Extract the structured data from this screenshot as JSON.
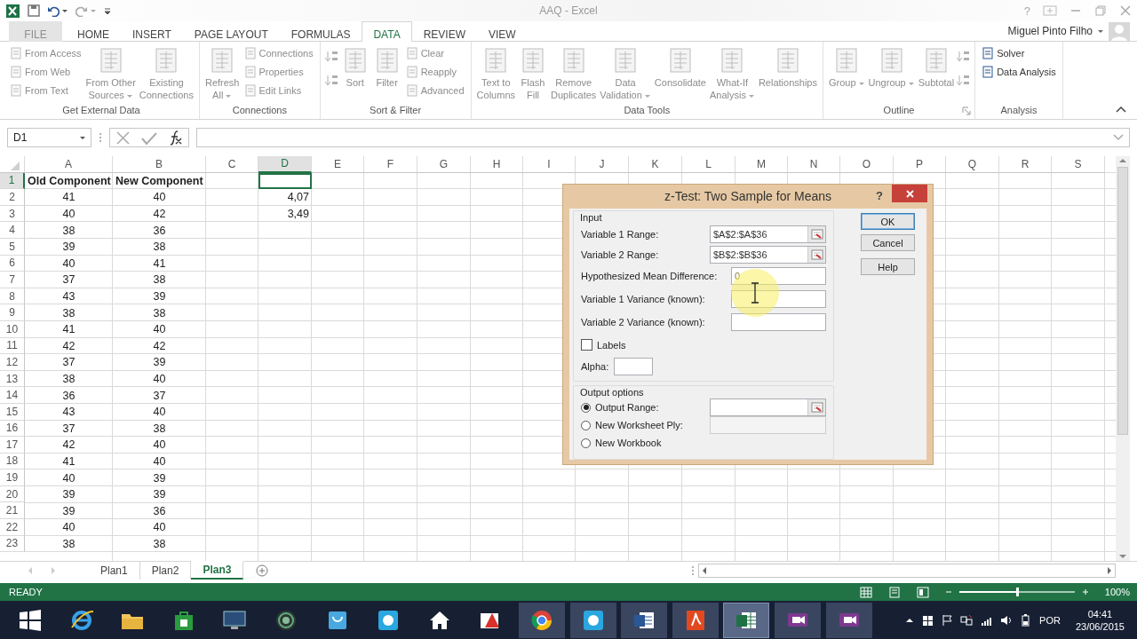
{
  "window": {
    "title": "AAQ - Excel",
    "help_glyph": "?"
  },
  "ribbon_tabs": [
    {
      "label": "FILE",
      "kind": "file",
      "selected": false
    },
    {
      "label": "HOME",
      "kind": "tab",
      "selected": false
    },
    {
      "label": "INSERT",
      "kind": "tab",
      "selected": false
    },
    {
      "label": "PAGE LAYOUT",
      "kind": "tab",
      "selected": false
    },
    {
      "label": "FORMULAS",
      "kind": "tab",
      "selected": false
    },
    {
      "label": "DATA",
      "kind": "tab",
      "selected": true
    },
    {
      "label": "REVIEW",
      "kind": "tab",
      "selected": false
    },
    {
      "label": "VIEW",
      "kind": "tab",
      "selected": false
    }
  ],
  "account": {
    "name": "Miguel Pinto Filho"
  },
  "ribbon_groups": [
    {
      "label": "Get External Data",
      "launcher": false,
      "items": [
        {
          "kind": "small",
          "label": "From Access",
          "disabled": true
        },
        {
          "kind": "small",
          "label": "From Web",
          "disabled": true
        },
        {
          "kind": "small",
          "label": "From Text",
          "disabled": true
        },
        {
          "kind": "large",
          "label": "From Other\nSources",
          "dropdown": true,
          "disabled": true
        },
        {
          "kind": "large",
          "label": "Existing\nConnections",
          "dropdown": false,
          "disabled": true
        }
      ]
    },
    {
      "label": "Connections",
      "launcher": false,
      "items": [
        {
          "kind": "large",
          "label": "Refresh\nAll",
          "dropdown": true,
          "disabled": true
        },
        {
          "kind": "small",
          "label": "Connections",
          "disabled": true
        },
        {
          "kind": "small",
          "label": "Properties",
          "disabled": true
        },
        {
          "kind": "small",
          "label": "Edit Links",
          "disabled": true
        }
      ]
    },
    {
      "label": "Sort & Filter",
      "launcher": false,
      "items": [
        {
          "kind": "icon",
          "disabled": true
        },
        {
          "kind": "icon",
          "disabled": true
        },
        {
          "kind": "large",
          "label": "Sort",
          "dropdown": false,
          "disabled": true
        },
        {
          "kind": "large",
          "label": "Filter",
          "dropdown": false,
          "disabled": true
        },
        {
          "kind": "small",
          "label": "Clear",
          "disabled": true
        },
        {
          "kind": "small",
          "label": "Reapply",
          "disabled": true
        },
        {
          "kind": "small",
          "label": "Advanced",
          "disabled": true
        }
      ]
    },
    {
      "label": "Data Tools",
      "launcher": false,
      "items": [
        {
          "kind": "large",
          "label": "Text to\nColumns",
          "dropdown": false,
          "disabled": true
        },
        {
          "kind": "large",
          "label": "Flash\nFill",
          "dropdown": false,
          "disabled": true
        },
        {
          "kind": "large",
          "label": "Remove\nDuplicates",
          "dropdown": false,
          "disabled": true
        },
        {
          "kind": "large",
          "label": "Data\nValidation",
          "dropdown": true,
          "disabled": true
        },
        {
          "kind": "large",
          "label": "Consolidate",
          "dropdown": false,
          "disabled": true
        },
        {
          "kind": "large",
          "label": "What-If\nAnalysis",
          "dropdown": true,
          "disabled": true
        },
        {
          "kind": "large",
          "label": "Relationships",
          "dropdown": false,
          "disabled": true
        }
      ]
    },
    {
      "label": "Outline",
      "launcher": true,
      "items": [
        {
          "kind": "large",
          "label": "Group",
          "dropdown": true,
          "disabled": true
        },
        {
          "kind": "large",
          "label": "Ungroup",
          "dropdown": true,
          "disabled": true
        },
        {
          "kind": "large",
          "label": "Subtotal",
          "dropdown": false,
          "disabled": true
        },
        {
          "kind": "icon",
          "disabled": true
        },
        {
          "kind": "icon",
          "disabled": true
        }
      ]
    },
    {
      "label": "Analysis",
      "launcher": false,
      "items": [
        {
          "kind": "small",
          "label": "Solver",
          "disabled": false
        },
        {
          "kind": "small",
          "label": "Data Analysis",
          "disabled": false
        }
      ]
    }
  ],
  "formula_bar": {
    "name_box": "D1"
  },
  "sheet": {
    "columns": [
      {
        "label": "A",
        "selected": false
      },
      {
        "label": "B",
        "selected": false
      },
      {
        "label": "C",
        "selected": false
      },
      {
        "label": "D",
        "selected": true
      },
      {
        "label": "E",
        "selected": false
      },
      {
        "label": "F",
        "selected": false
      },
      {
        "label": "G",
        "selected": false
      },
      {
        "label": "H",
        "selected": false
      },
      {
        "label": "I",
        "selected": false
      },
      {
        "label": "J",
        "selected": false
      },
      {
        "label": "K",
        "selected": false
      },
      {
        "label": "L",
        "selected": false
      },
      {
        "label": "M",
        "selected": false
      },
      {
        "label": "N",
        "selected": false
      },
      {
        "label": "O",
        "selected": false
      },
      {
        "label": "P",
        "selected": false
      },
      {
        "label": "Q",
        "selected": false
      },
      {
        "label": "R",
        "selected": false
      },
      {
        "label": "S",
        "selected": false
      }
    ],
    "rows": [
      {
        "number": "1",
        "kind": "header",
        "selected": true,
        "column_a": "Old Component",
        "column_b": "New Component"
      },
      {
        "number": "2",
        "kind": "data",
        "selected": false,
        "column_a": "41",
        "column_b": "40",
        "column_d": "4,07"
      },
      {
        "number": "3",
        "kind": "data",
        "selected": false,
        "column_a": "40",
        "column_b": "42",
        "column_d": "3,49"
      },
      {
        "number": "4",
        "kind": "data",
        "selected": false,
        "column_a": "38",
        "column_b": "36"
      },
      {
        "number": "5",
        "kind": "data",
        "selected": false,
        "column_a": "39",
        "column_b": "38"
      },
      {
        "number": "6",
        "kind": "data",
        "selected": false,
        "column_a": "40",
        "column_b": "41"
      },
      {
        "number": "7",
        "kind": "data",
        "selected": false,
        "column_a": "37",
        "column_b": "38"
      },
      {
        "number": "8",
        "kind": "data",
        "selected": false,
        "column_a": "43",
        "column_b": "39"
      },
      {
        "number": "9",
        "kind": "data",
        "selected": false,
        "column_a": "38",
        "column_b": "38"
      },
      {
        "number": "10",
        "kind": "data",
        "selected": false,
        "column_a": "41",
        "column_b": "40"
      },
      {
        "number": "11",
        "kind": "data",
        "selected": false,
        "column_a": "42",
        "column_b": "42"
      },
      {
        "number": "12",
        "kind": "data",
        "selected": false,
        "column_a": "37",
        "column_b": "39"
      },
      {
        "number": "13",
        "kind": "data",
        "selected": false,
        "column_a": "38",
        "column_b": "40"
      },
      {
        "number": "14",
        "kind": "data",
        "selected": false,
        "column_a": "36",
        "column_b": "37"
      },
      {
        "number": "15",
        "kind": "data",
        "selected": false,
        "column_a": "43",
        "column_b": "40"
      },
      {
        "number": "16",
        "kind": "data",
        "selected": false,
        "column_a": "37",
        "column_b": "38"
      },
      {
        "number": "17",
        "kind": "data",
        "selected": false,
        "column_a": "42",
        "column_b": "40"
      },
      {
        "number": "18",
        "kind": "data",
        "selected": false,
        "column_a": "41",
        "column_b": "40"
      },
      {
        "number": "19",
        "kind": "data",
        "selected": false,
        "column_a": "40",
        "column_b": "39"
      },
      {
        "number": "20",
        "kind": "data",
        "selected": false,
        "column_a": "39",
        "column_b": "39"
      },
      {
        "number": "21",
        "kind": "data",
        "selected": false,
        "column_a": "39",
        "column_b": "36"
      },
      {
        "number": "22",
        "kind": "data",
        "selected": false,
        "column_a": "40",
        "column_b": "40"
      },
      {
        "number": "23",
        "kind": "data",
        "selected": false,
        "column_a": "38",
        "column_b": "38"
      }
    ]
  },
  "sheet_tabs": [
    {
      "label": "Plan1",
      "selected": false
    },
    {
      "label": "Plan2",
      "selected": false
    },
    {
      "label": "Plan3",
      "selected": true
    }
  ],
  "status_bar": {
    "status": "READY",
    "zoom": "100%",
    "zoom_slider": {
      "level": 0.5
    }
  },
  "dialog": {
    "title": "z-Test: Two Sample for Means",
    "help_glyph": "?",
    "input": {
      "label": "Input",
      "fields": [
        {
          "kind": "range",
          "label": "Variable 1 Range:",
          "value": "$A$2:$A$36"
        },
        {
          "kind": "range",
          "label": "Variable 2 Range:",
          "value": "$B$2:$B$36"
        },
        {
          "kind": "text",
          "label": "Hypothesized Mean Difference:",
          "value": "0"
        },
        {
          "kind": "text",
          "label": "Variable 1 Variance (known):"
        },
        {
          "kind": "text",
          "label": "Variable 2 Variance (known):"
        }
      ],
      "labels_checkbox": {
        "label": "Labels",
        "checked": false
      },
      "alpha": {
        "label": "Alpha:"
      }
    },
    "output": {
      "label": "Output options",
      "options": [
        {
          "label": "Output Range:",
          "selected": true,
          "kind": "range"
        },
        {
          "label": "New Worksheet Ply:",
          "selected": false,
          "kind": "disabled"
        },
        {
          "label": "New Workbook",
          "selected": false,
          "kind": "plain"
        }
      ]
    },
    "buttons": [
      {
        "label": "OK",
        "default": true
      },
      {
        "label": "Cancel",
        "default": false
      },
      {
        "label": "Help",
        "default": false
      }
    ]
  },
  "taskbar": {
    "apps": [
      {
        "kind": "start",
        "running": false,
        "selected": false
      },
      {
        "kind": "browser",
        "running": false,
        "selected": false
      },
      {
        "kind": "folder",
        "running": false,
        "selected": false
      },
      {
        "kind": "store",
        "running": false,
        "selected": false
      },
      {
        "kind": "monitor",
        "running": false,
        "selected": false
      },
      {
        "kind": "ring",
        "running": false,
        "selected": false
      },
      {
        "kind": "bag",
        "running": false,
        "selected": false
      },
      {
        "kind": "chat",
        "running": false,
        "selected": false
      },
      {
        "kind": "home",
        "running": false,
        "selected": false
      },
      {
        "kind": "pen",
        "running": false,
        "selected": false
      },
      {
        "kind": "globe",
        "running": true,
        "selected": false
      },
      {
        "kind": "chat",
        "running": true,
        "selected": false
      },
      {
        "kind": "doc",
        "running": true,
        "selected": false
      },
      {
        "kind": "pdf",
        "running": true,
        "selected": false
      },
      {
        "kind": "sheet",
        "running": true,
        "selected": true
      },
      {
        "kind": "video",
        "running": true,
        "selected": false
      },
      {
        "kind": "video",
        "running": true,
        "selected": false
      }
    ],
    "language": "POR",
    "time": "04:41",
    "date": "23/06/2015"
  }
}
